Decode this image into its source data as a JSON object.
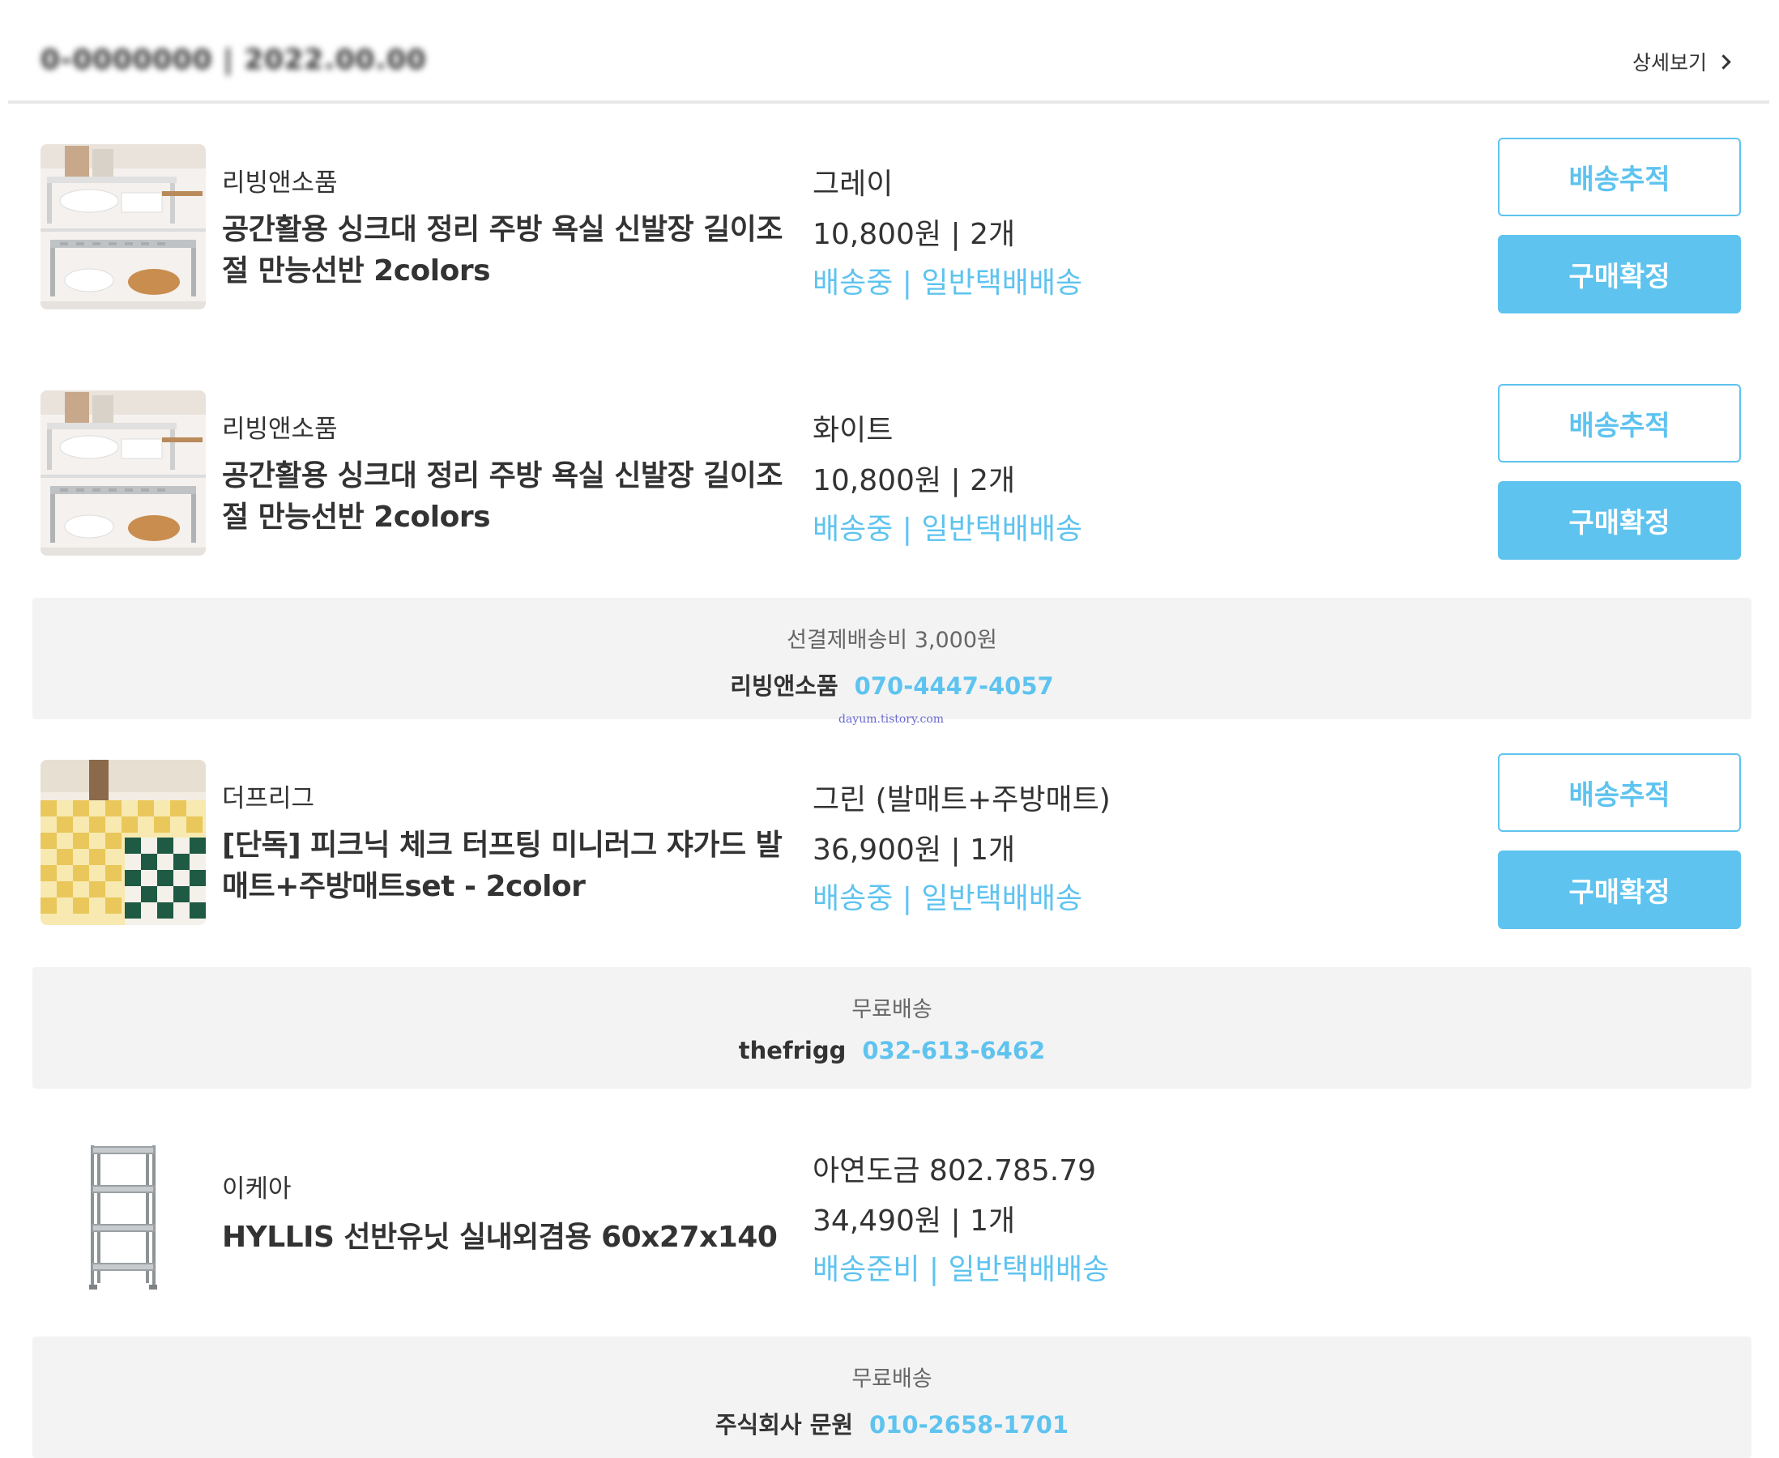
{
  "header": {
    "order_id": "0-0000000 | 2022.00.00",
    "detail_label": "상세보기"
  },
  "items": [
    {
      "seller": "리빙앤소품",
      "title": "공간활용 싱크대 정리 주방 욕실 신발장 길이조절 만능선반 2colors",
      "option": "그레이",
      "price": "10,800원 | 2개",
      "status": "배송중 | 일반택배배송",
      "track_label": "배송추적",
      "confirm_label": "구매확정",
      "thumb_icon": "shelf-photo-icon"
    },
    {
      "seller": "리빙앤소품",
      "title": "공간활용 싱크대 정리 주방 욕실 신발장 길이조절 만능선반 2colors",
      "option": "화이트",
      "price": "10,800원 | 2개",
      "status": "배송중 | 일반택배배송",
      "track_label": "배송추적",
      "confirm_label": "구매확정",
      "thumb_icon": "shelf-photo-icon"
    },
    {
      "seller": "더프리그",
      "title": "[단독] 피크닉 체크 터프팅 미니러그 쟈가드 발매트+주방매트set - 2color",
      "option": "그린 (발매트+주방매트)",
      "price": "36,900원 | 1개",
      "status": "배송중 | 일반택배배송",
      "track_label": "배송추적",
      "confirm_label": "구매확정",
      "thumb_icon": "check-rug-photo-icon"
    },
    {
      "seller": "이케아",
      "title": "HYLLIS 선반유닛 실내외겸용 60x27x140",
      "option": "아연도금 802.785.79",
      "price": "34,490원 | 1개",
      "status": "배송준비 | 일반택배배송",
      "thumb_icon": "metal-shelf-unit-icon"
    }
  ],
  "shipping": [
    {
      "fee": "선결제배송비 3,000원",
      "seller": "리빙앤소품",
      "phone": "070-4447-4057"
    },
    {
      "fee": "무료배송",
      "seller": "thefrigg",
      "phone": "032-613-6462"
    },
    {
      "fee": "무료배송",
      "seller": "주식회사 문원",
      "phone": "010-2658-1701"
    }
  ],
  "watermark": "dayum.tistory.com",
  "colors": {
    "accent": "#5ec3ef",
    "ship_box_bg": "#f3f3f3",
    "text": "#333333"
  }
}
